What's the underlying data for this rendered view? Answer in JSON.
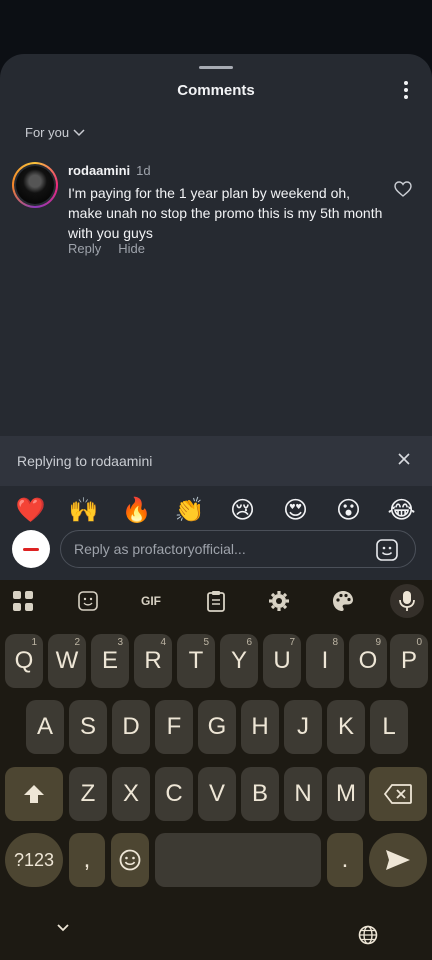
{
  "sheet": {
    "title": "Comments",
    "filter_label": "For you"
  },
  "comment": {
    "username": "rodaamini",
    "time": "1d",
    "text": "I'm paying for the 1 year plan by weekend oh, make unah no stop the promo this is my 5th month with you guys",
    "reply_label": "Reply",
    "hide_label": "Hide"
  },
  "replying": {
    "text": "Replying to rodaamini"
  },
  "emojis": [
    "❤️",
    "🙌",
    "🔥",
    "👏",
    "😢",
    "😍",
    "😮",
    "😂"
  ],
  "reply_input": {
    "placeholder": "Reply as profactoryofficial..."
  },
  "keyboard": {
    "gif_label": "GIF",
    "row1": [
      {
        "key": "Q",
        "num": "1"
      },
      {
        "key": "W",
        "num": "2"
      },
      {
        "key": "E",
        "num": "3"
      },
      {
        "key": "R",
        "num": "4"
      },
      {
        "key": "T",
        "num": "5"
      },
      {
        "key": "Y",
        "num": "6"
      },
      {
        "key": "U",
        "num": "7"
      },
      {
        "key": "I",
        "num": "8"
      },
      {
        "key": "O",
        "num": "9"
      },
      {
        "key": "P",
        "num": "0"
      }
    ],
    "row2": [
      "A",
      "S",
      "D",
      "F",
      "G",
      "H",
      "J",
      "K",
      "L"
    ],
    "row3": [
      "Z",
      "X",
      "C",
      "V",
      "B",
      "N",
      "M"
    ],
    "symbols_label": "?123",
    "comma": ",",
    "period": "."
  }
}
